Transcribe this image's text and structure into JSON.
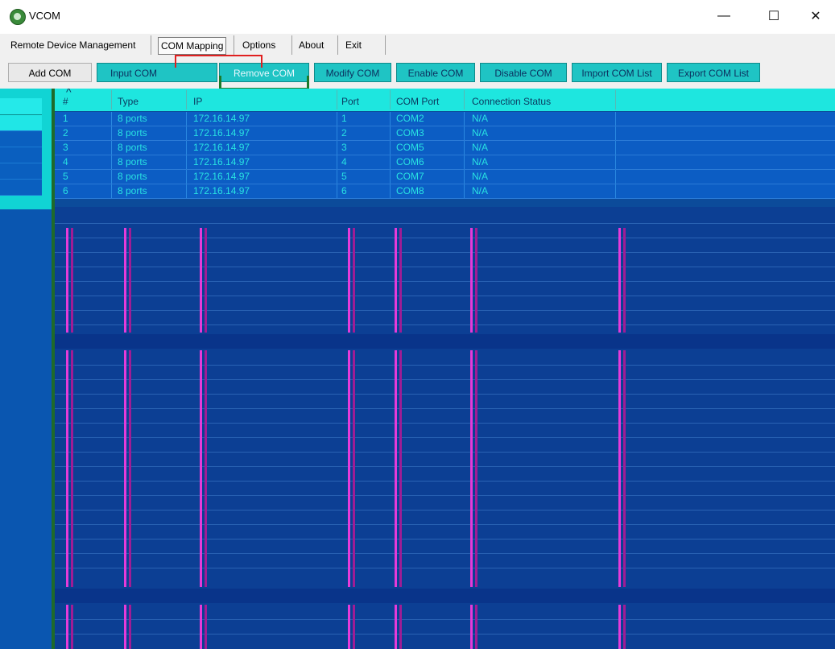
{
  "window": {
    "title": "VCOM",
    "minimize_glyph": "—",
    "maximize_glyph": "☐",
    "close_glyph": "✕",
    "icon": "globe-icon"
  },
  "menu": {
    "items": [
      "Remote Device Management",
      "COM Mapping",
      "Options",
      "About",
      "Exit"
    ]
  },
  "toolbar": {
    "buttons": [
      {
        "label": "Add COM"
      },
      {
        "label": "Input COM"
      },
      {
        "label": "Remove COM"
      },
      {
        "label": "Modify COM"
      },
      {
        "label": "Enable COM"
      },
      {
        "label": "Disable COM"
      },
      {
        "label": "Import COM List"
      },
      {
        "label": "Export COM List"
      }
    ]
  },
  "table": {
    "sort_indicator": "^",
    "columns": [
      "#",
      "Type",
      "IP",
      "Port",
      "COM Port",
      "Connection Status"
    ],
    "rows": [
      {
        "num": "1",
        "type": "8 ports",
        "ip": "172.16.14.97",
        "port": "1",
        "com": "COM2",
        "status": "N/A"
      },
      {
        "num": "2",
        "type": "8 ports",
        "ip": "172.16.14.97",
        "port": "2",
        "com": "COM3",
        "status": "N/A"
      },
      {
        "num": "3",
        "type": "8 ports",
        "ip": "172.16.14.97",
        "port": "3",
        "com": "COM5",
        "status": "N/A"
      },
      {
        "num": "4",
        "type": "8 ports",
        "ip": "172.16.14.97",
        "port": "4",
        "com": "COM6",
        "status": "N/A"
      },
      {
        "num": "5",
        "type": "8 ports",
        "ip": "172.16.14.97",
        "port": "5",
        "com": "COM7",
        "status": "N/A"
      },
      {
        "num": "6",
        "type": "8 ports",
        "ip": "172.16.14.97",
        "port": "6",
        "com": "COM8",
        "status": "N/A"
      }
    ]
  },
  "colors": {
    "accent_cyan": "#1ee6df",
    "row_blue": "#0c5dc4",
    "glitch_magenta": "#e63bd9",
    "highlight_red": "#e02020",
    "highlight_green": "#1d7a2a"
  }
}
